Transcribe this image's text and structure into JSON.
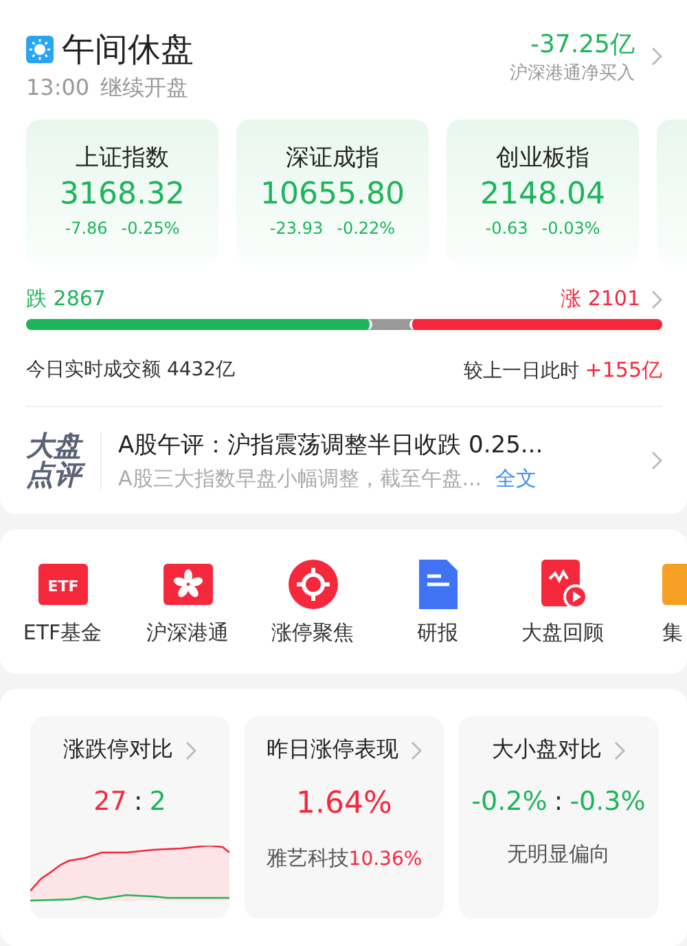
{
  "header": {
    "title": "午间休盘",
    "time": "13:00",
    "subtitle": "继续开盘",
    "flow_value": "-37.25亿",
    "flow_label": "沪深港通净买入"
  },
  "indices": [
    {
      "name": "上证指数",
      "value": "3168.32",
      "change": "-7.86",
      "percent": "-0.25%",
      "color": "#1db45a"
    },
    {
      "name": "深证成指",
      "value": "10655.80",
      "change": "-23.93",
      "percent": "-0.22%",
      "color": "#1db45a"
    },
    {
      "name": "创业板指",
      "value": "2148.04",
      "change": "-0.63",
      "percent": "-0.03%",
      "color": "#1db45a"
    }
  ],
  "breadth": {
    "fall_label": "跌",
    "fall_count": "2867",
    "rise_label": "涨",
    "rise_count": "2101",
    "segments": [
      {
        "kind": "fall",
        "level": 0.545
      },
      {
        "kind": "rise",
        "level": 0.397
      }
    ]
  },
  "turnover": {
    "label": "今日实时成交额",
    "value": "4432亿",
    "compare_label": "较上一日此时",
    "compare_value": "+155亿"
  },
  "commentary": {
    "logo_top": "大盘",
    "logo_bottom": "点评",
    "headline": "A股午评：沪指震荡调整半日收跌 0.25...",
    "summary": "A股三大指数早盘小幅调整，截至午盘...",
    "link": "全文"
  },
  "shortcuts": [
    {
      "kind": "etf",
      "label": "ETF基金",
      "icon_text": "ETF"
    },
    {
      "kind": "hk",
      "label": "沪深港通"
    },
    {
      "kind": "target",
      "label": "涨停聚焦"
    },
    {
      "kind": "doc",
      "label": "研报"
    },
    {
      "kind": "replay",
      "label": "大盘回顾"
    },
    {
      "kind": "partial",
      "label": "集"
    }
  ],
  "stats": [
    {
      "kind": "ratio",
      "title": "涨跌停对比",
      "sep": ":",
      "parts": [
        {
          "text": "27",
          "color": "#f5283c"
        },
        {
          "text": "2",
          "color": "#1db45a"
        }
      ]
    },
    {
      "kind": "value",
      "title": "昨日涨停表现",
      "value": "1.64%",
      "color": "#f5283c",
      "note_name": "雅艺科技",
      "note_value": "10.36%"
    },
    {
      "kind": "ratio",
      "title": "大小盘对比",
      "sep": ":",
      "parts": [
        {
          "text": "-0.2%",
          "color": "#1db45a"
        },
        {
          "text": "-0.3%",
          "color": "#1db45a"
        }
      ],
      "note": "无明显偏向"
    }
  ]
}
